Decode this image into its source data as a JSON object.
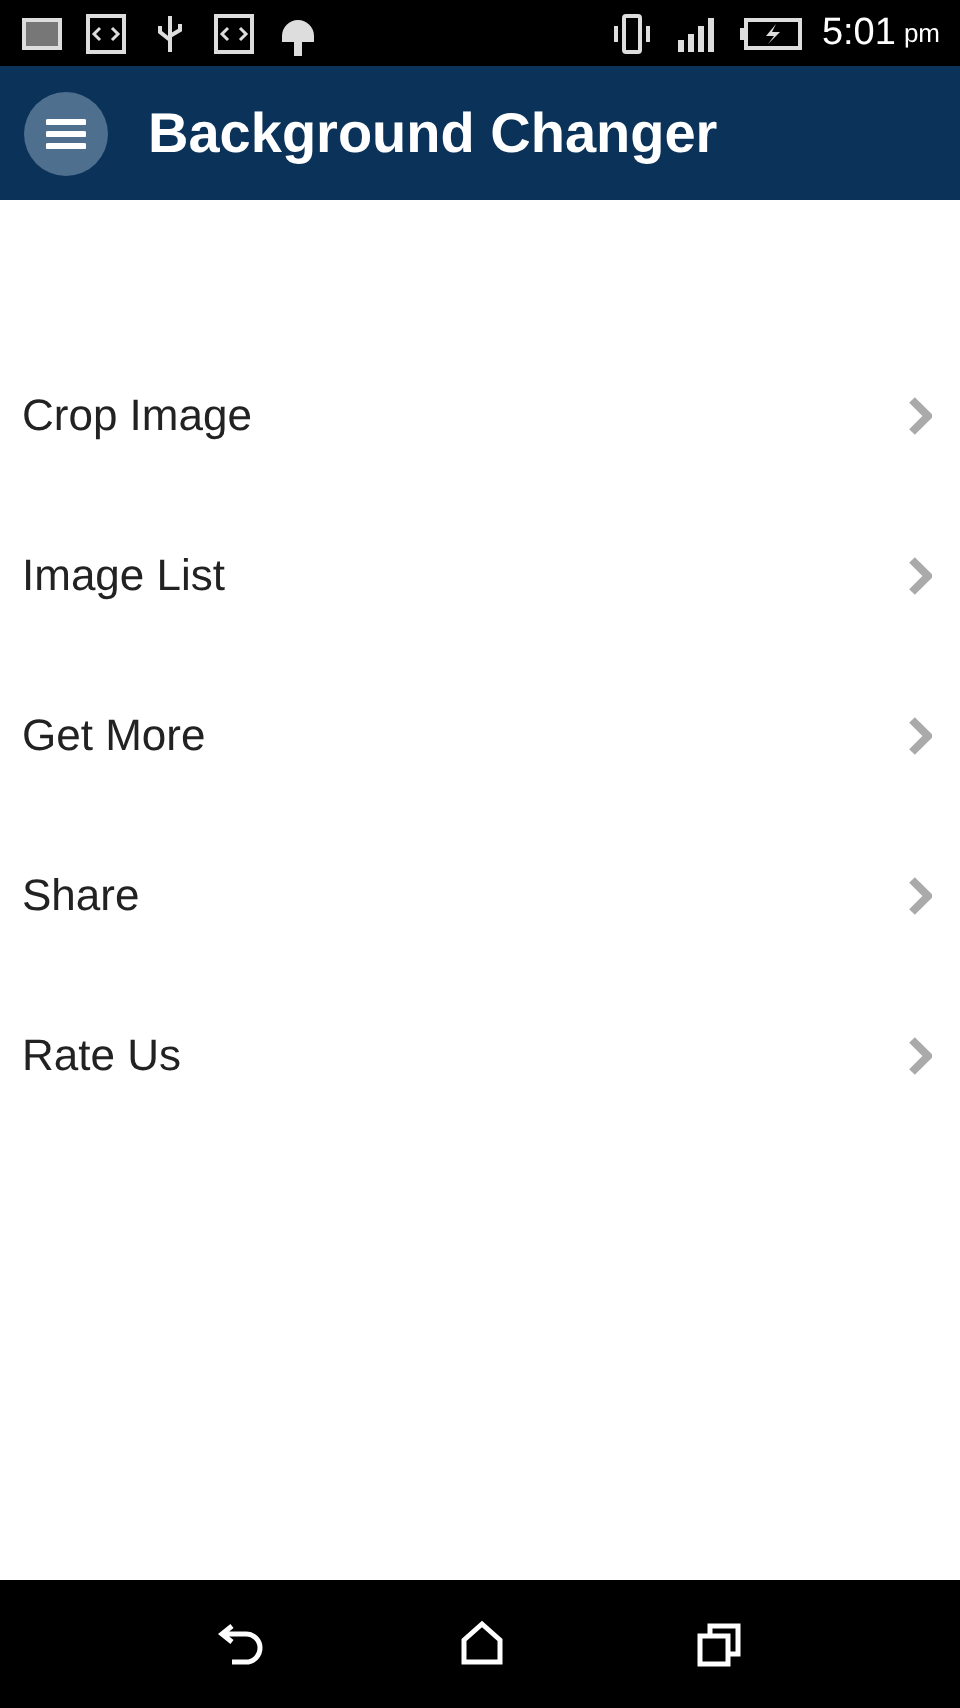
{
  "status_bar": {
    "time": "5:01",
    "time_suffix": "pm"
  },
  "app_bar": {
    "title": "Background Changer"
  },
  "menu": [
    {
      "label": "Crop Image"
    },
    {
      "label": "Image List"
    },
    {
      "label": "Get More"
    },
    {
      "label": "Share"
    },
    {
      "label": "Rate Us"
    }
  ]
}
